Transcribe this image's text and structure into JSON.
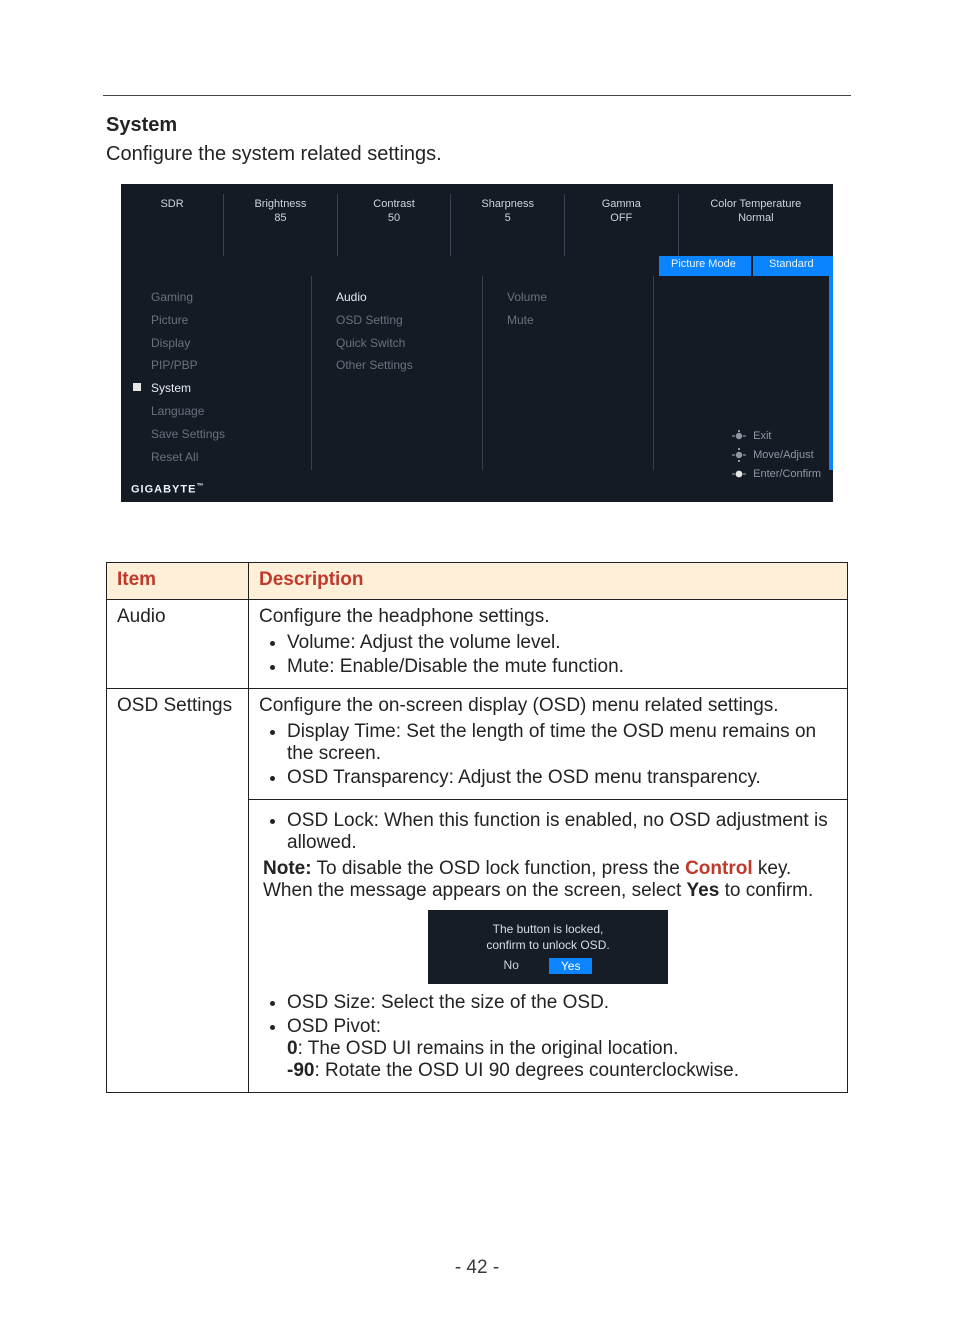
{
  "section": {
    "title": "System",
    "subtitle": "Configure the system related settings."
  },
  "osd": {
    "top": [
      {
        "label": "SDR",
        "value": ""
      },
      {
        "label": "Brightness",
        "value": "85"
      },
      {
        "label": "Contrast",
        "value": "50"
      },
      {
        "label": "Sharpness",
        "value": "5"
      },
      {
        "label": "Gamma",
        "value": "OFF"
      },
      {
        "label": "Color Temperature",
        "value": "Normal"
      }
    ],
    "mode_row": {
      "picture_mode": "Picture Mode",
      "standard": "Standard"
    },
    "col1": [
      "Gaming",
      "Picture",
      "Display",
      "PIP/PBP",
      "System",
      "Language",
      "Save Settings",
      "Reset All"
    ],
    "col1_selected_index": 4,
    "col2": [
      "Audio",
      "OSD Setting",
      "Quick Switch",
      "Other Settings"
    ],
    "col2_highlight_index": 0,
    "col3": [
      "Volume",
      "Mute"
    ],
    "hints": {
      "exit": "Exit",
      "move": "Move/Adjust",
      "enter": "Enter/Confirm"
    },
    "logo": "GIGABYTE"
  },
  "table": {
    "head": {
      "item": "Item",
      "desc": "Description"
    },
    "rows": {
      "audio": {
        "item": "Audio",
        "intro": "Configure the headphone settings.",
        "bullets": [
          "Volume: Adjust the volume level.",
          "Mute: Enable/Disable the mute function."
        ]
      },
      "osd1": {
        "item": "OSD Settings",
        "intro": "Configure the on-screen display (OSD) menu related settings.",
        "bullets": [
          "Display Time: Set the length of time the OSD menu remains on the screen.",
          "OSD Transparency: Adjust the OSD menu transparency."
        ]
      },
      "osd2": {
        "lock_bullet": "OSD Lock: When this function is enabled, no OSD adjustment is allowed.",
        "note_label": "Note:",
        "note_text_1": " To disable the OSD lock function, press the ",
        "control_word": "Control",
        "note_text_2": " key. When the message appears on the screen, select ",
        "yes_word": "Yes",
        "note_text_3": " to confirm.",
        "dialog": {
          "line1": "The button is locked,",
          "line2": "confirm to unlock OSD.",
          "no": "No",
          "yes": "Yes"
        },
        "size_bullet": "OSD Size: Select the size of the OSD.",
        "pivot_label": "OSD Pivot:",
        "pivot_0_label": "0",
        "pivot_0_text": ": The OSD UI remains in the original location.",
        "pivot_90_label": "-90",
        "pivot_90_text": ": Rotate the OSD UI 90 degrees counterclockwise."
      }
    }
  },
  "page_number": "- 42 -"
}
